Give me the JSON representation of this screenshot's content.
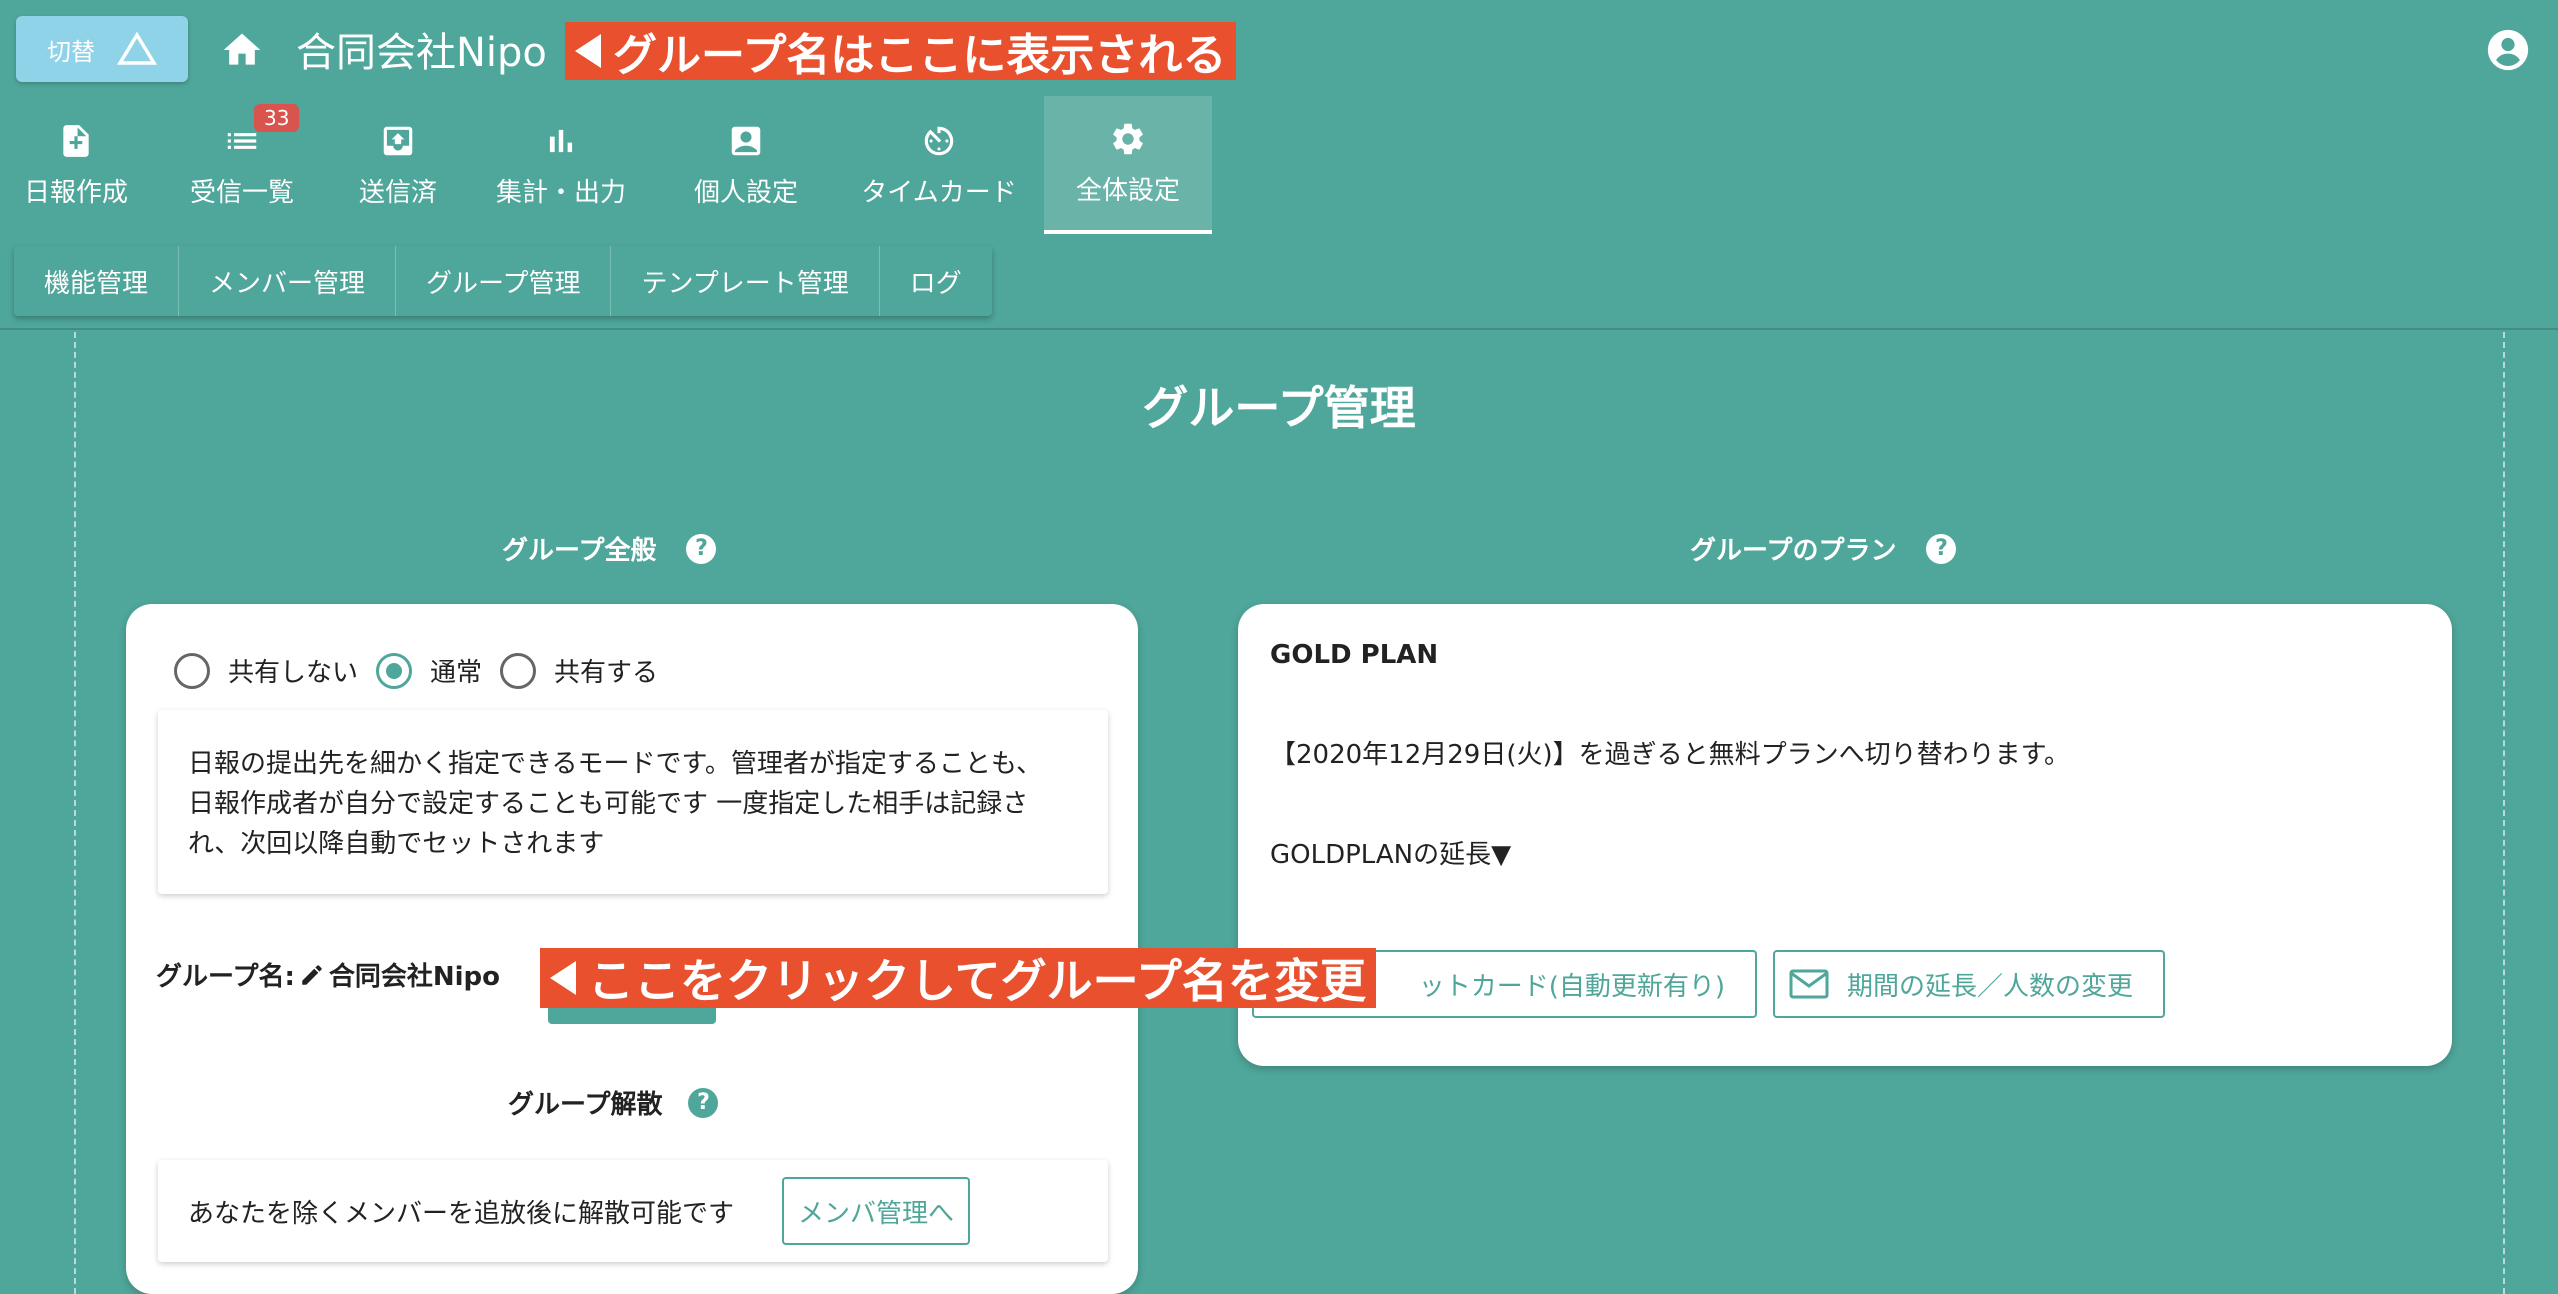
{
  "header": {
    "switch_label": "切替",
    "company": "合同会社Nipo",
    "callout_top": "グループ名はここに表示される"
  },
  "nav": {
    "items": [
      {
        "label": "日報作成",
        "icon": "add-document-icon"
      },
      {
        "label": "受信一覧",
        "icon": "list-icon",
        "badge": "33"
      },
      {
        "label": "送信済",
        "icon": "outbox-icon"
      },
      {
        "label": "集計・出力",
        "icon": "bar-chart-icon"
      },
      {
        "label": "個人設定",
        "icon": "person-card-icon"
      },
      {
        "label": "タイムカード",
        "icon": "timer-icon"
      },
      {
        "label": "全体設定",
        "icon": "gear-icon",
        "active": true
      }
    ]
  },
  "subnav": {
    "items": [
      "機能管理",
      "メンバー管理",
      "グループ管理",
      "テンプレート管理",
      "ログ"
    ]
  },
  "page": {
    "title": "グループ管理"
  },
  "general": {
    "label": "グループ全般",
    "radios": [
      {
        "label": "共有しない",
        "selected": false
      },
      {
        "label": "通常",
        "selected": true
      },
      {
        "label": "共有する",
        "selected": false
      }
    ],
    "desc": [
      "日報の提出先を細かく指定できるモードです。管理者が指定することも、",
      "日報作成者が自分で設定することも可能です 一度指定した相手は記録さ",
      "れ、次回以降自動でセットされます"
    ],
    "group_name_prefix": "グループ名:",
    "group_name_value": "合同会社Nipo",
    "callout_edit": "ここをクリックしてグループ名を変更",
    "dissolve_label": "グループ解散",
    "dissolve_text": "あなたを除くメンバーを追放後に解散可能です",
    "dissolve_button": "メンバ管理へ"
  },
  "plan": {
    "label": "グループのプラン",
    "name": "GOLD PLAN",
    "notice": "【2020年12月29日(火)】を過ぎると無料プランへ切り替わります。",
    "extend": "GOLDPLANの延長▼",
    "btn_card": "ットカード(自動更新有り)",
    "btn_period": "期間の延長／人数の変更"
  },
  "colors": {
    "background": "#4fa69a",
    "switch": "#8ed3e8",
    "callout": "#e8502e",
    "badge": "#d9534f"
  }
}
